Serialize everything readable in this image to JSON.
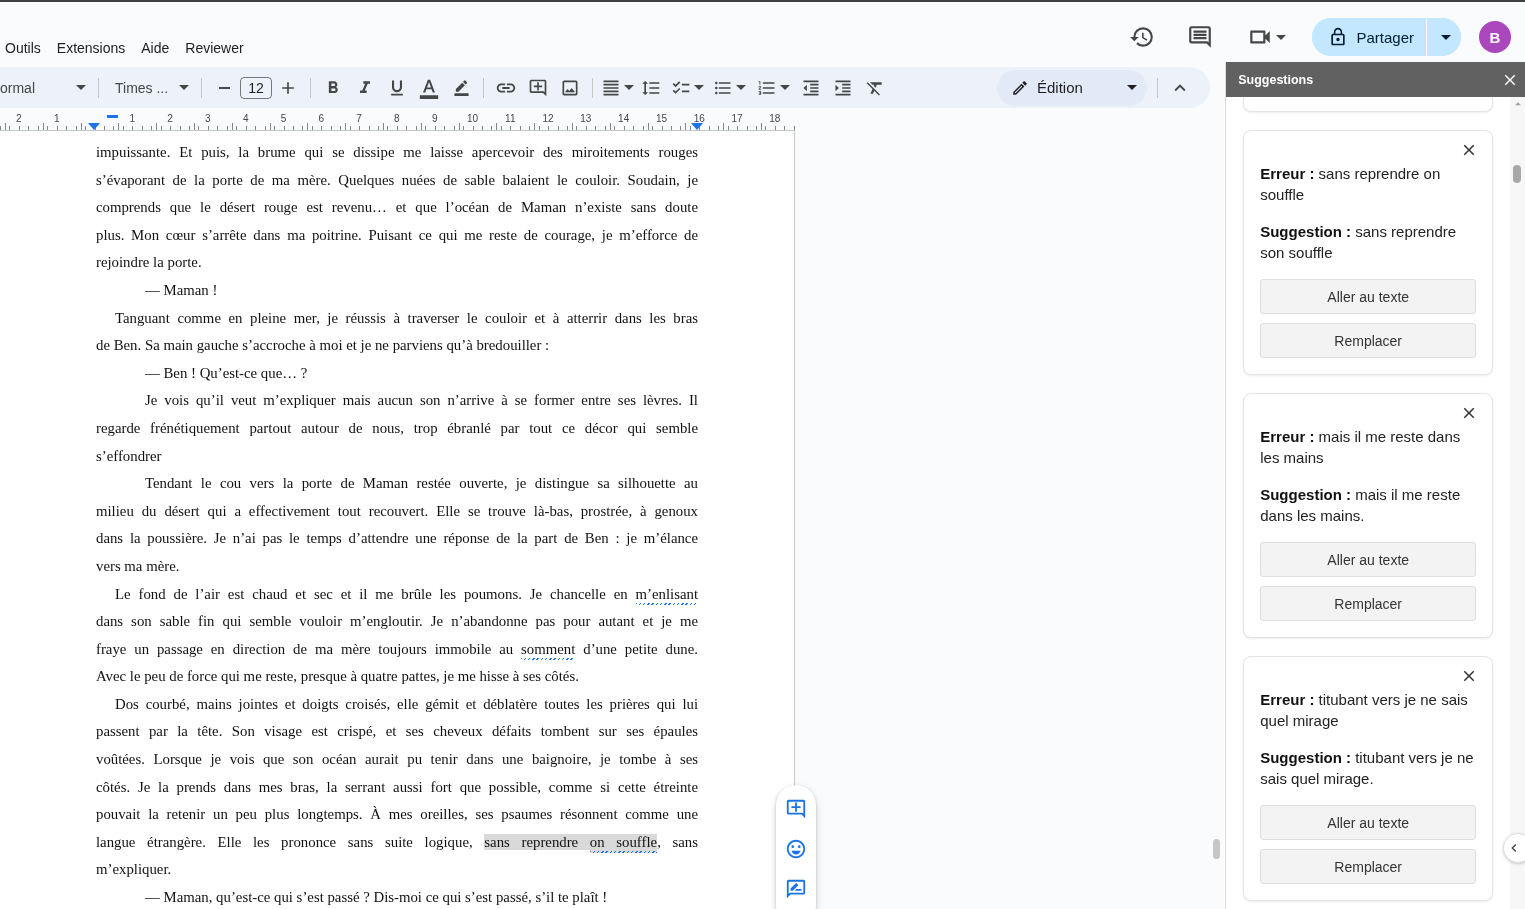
{
  "menu": [
    "Outils",
    "Extensions",
    "Aide",
    "Reviewer"
  ],
  "header": {
    "share": "Partager",
    "avatar": "B"
  },
  "toolbar": {
    "style": "ormal",
    "font": "Times ...",
    "size": "12",
    "mode": "Édition"
  },
  "ruler": [
    "2",
    "1",
    "1",
    "2",
    "3",
    "4",
    "5",
    "6",
    "7",
    "8",
    "9",
    "10",
    "11",
    "12",
    "13",
    "14",
    "15",
    "16",
    "17",
    "18"
  ],
  "doc": {
    "paragraphs": [
      {
        "kind": "continuation",
        "lines": [
          "impuissante. Et puis, la brume qui se dissipe me laisse apercevoir des miroitements rouges",
          "s’évaporant de la porte de ma mère. Quelques nuées de sable balaient le couloir. Soudain, je",
          "comprends que le désert rouge est revenu… et que l’océan de Maman n’existe sans doute",
          "plus. Mon cœur s’arrête dans ma poitrine. Puisant ce qui me reste de courage, je m’efforce de",
          "rejoindre la porte."
        ]
      },
      {
        "kind": "indented",
        "lines": [
          "— Maman !"
        ]
      },
      {
        "kind": "paragraph",
        "lines": [
          "Tanguant comme en pleine mer, je réussis à traverser le couloir et à atterrir dans les bras",
          "de Ben. Sa main gauche s’accroche à moi et je ne parviens qu’à bredouiller :"
        ]
      },
      {
        "kind": "indented",
        "lines": [
          "— Ben ! Qu’est-ce que… ?"
        ]
      },
      {
        "kind": "indented",
        "lines": [
          "Je vois qu’il veut m’expliquer mais aucun son n’arrive à se former entre ses lèvres. Il",
          "regarde frénétiquement partout autour de nous, trop ébranlé par tout ce décor qui semble",
          "s’effondrer"
        ]
      },
      {
        "kind": "indented",
        "lines": [
          "Tendant le cou vers la porte de Maman restée ouverte, je distingue sa silhouette au",
          "milieu du désert qui a effectivement tout recouvert. Elle se trouve là-bas, prostrée, à genoux",
          "dans la poussière. Je n’ai pas le temps d’attendre une réponse de la part de Ben : je m’élance",
          "vers ma mère."
        ]
      },
      {
        "kind": "paragraph",
        "lines": [
          [
            {
              "text": "Le fond de l’air est chaud et sec et il me brûle les poumons. Je chancelle en ",
              "spelling": false,
              "highlighted": false
            },
            {
              "text": "m’enlisant",
              "spelling": true,
              "highlighted": false
            }
          ],
          "dans son sable fin qui semble vouloir m’engloutir. Je n’abandonne pas pour autant et je me",
          [
            {
              "text": "fraye un passage en direction de ma mère toujours immobile au ",
              "spelling": false,
              "highlighted": false
            },
            {
              "text": "somment",
              "spelling": true,
              "highlighted": false
            },
            {
              "text": " d’une petite dune.",
              "spelling": false,
              "highlighted": false
            }
          ],
          "Avec le peu de force qui me reste, presque à quatre pattes, je me hisse à ses côtés."
        ]
      },
      {
        "kind": "paragraph",
        "lines": [
          "Dos courbé, mains jointes et doigts croisés, elle gémit et déblatère toutes les prières qui lui",
          "passent par la tête. Son visage est crispé, et ses cheveux défaits tombent sur ses épaules",
          "voûtées. Lorsque je vois que son océan aurait pu tenir dans une baignoire, je tombe à ses",
          "côtés. Je la prends dans mes bras, la serrant aussi fort que possible, comme si cette étreinte",
          "pouvait la retenir un peu plus longtemps. À mes oreilles, ses psaumes résonnent comme une",
          [
            {
              "text": "langue étrangère. Elle les prononce sans suite logique, ",
              "spelling": false,
              "highlighted": false
            },
            {
              "text": "sans reprendre ",
              "spelling": false,
              "highlighted": true
            },
            {
              "text": "on souffle",
              "spelling": true,
              "highlighted": true
            },
            {
              "text": ", sans",
              "spelling": false,
              "highlighted": false
            }
          ],
          "m’expliquer."
        ]
      },
      {
        "kind": "indented",
        "lines": [
          "— Maman, qu’est-ce qui s’est passé ? Dis-moi ce qui s’est passé, s’il te plaît !"
        ]
      }
    ]
  },
  "sidebar": {
    "title": "Suggestions",
    "cards": [
      {
        "error": "**Erreur :** sans reprendre on souffle",
        "suggestion": "**Suggestion :** sans reprendre son souffle",
        "buttons": [
          "Aller au texte",
          "Remplacer"
        ]
      },
      {
        "error": "**Erreur :** mais il me reste dans les mains",
        "suggestion": "**Suggestion :** mais il me reste dans les mains.",
        "buttons": [
          "Aller au texte",
          "Remplacer"
        ]
      },
      {
        "error": "**Erreur :** titubant vers je ne sais quel mirage",
        "suggestion": "**Suggestion :** titubant vers je ne sais quel mirage.",
        "buttons": [
          "Aller au texte",
          "Remplacer"
        ]
      }
    ]
  }
}
